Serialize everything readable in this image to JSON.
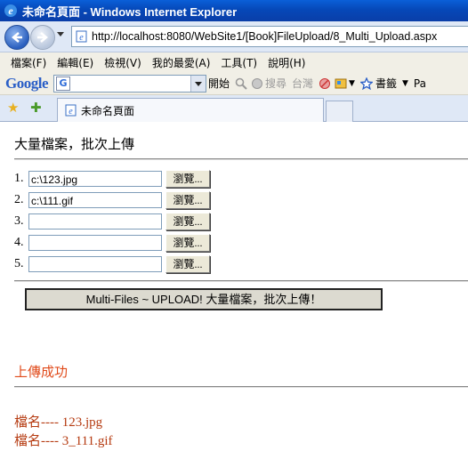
{
  "window": {
    "title": "未命名頁面 - Windows Internet Explorer"
  },
  "address": {
    "url": "http://localhost:8080/WebSite1/[Book]FileUpload/8_Multi_Upload.aspx"
  },
  "menu": [
    "檔案(F)",
    "編輯(E)",
    "檢視(V)",
    "我的最愛(A)",
    "工具(T)",
    "說明(H)"
  ],
  "google_toolbar": {
    "logo": "Google",
    "start": "開始",
    "search": "搜尋",
    "region": "台灣",
    "bookmarks": "書籤",
    "extra": "Pa"
  },
  "tab": {
    "title": "未命名頁面"
  },
  "page": {
    "heading": "大量檔案，批次上傳",
    "files": [
      {
        "num": "1.",
        "value": "c:\\123.jpg"
      },
      {
        "num": "2.",
        "value": "c:\\111.gif"
      },
      {
        "num": "3.",
        "value": ""
      },
      {
        "num": "4.",
        "value": ""
      },
      {
        "num": "5.",
        "value": ""
      }
    ],
    "browse_label": "瀏覽...",
    "upload_button": "Multi-Files ~ UPLOAD!  大量檔案，批次上傳！",
    "status": "上傳成功",
    "results": [
      "檔名---- 123.jpg",
      "檔名---- 3_111.gif"
    ]
  },
  "colors": {
    "status": "#e04a1a",
    "titlebar": "#0a5fd8"
  }
}
